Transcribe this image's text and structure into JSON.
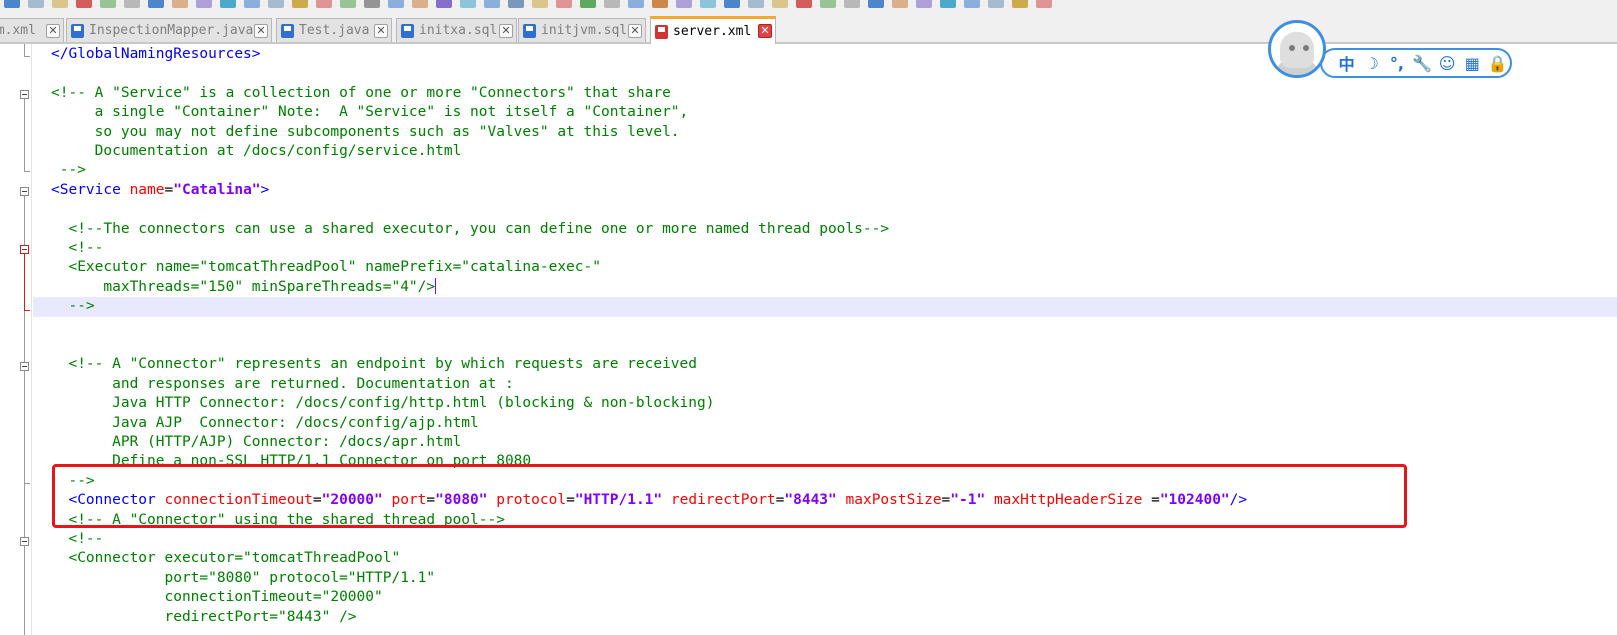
{
  "tabs": [
    {
      "label": "om.xml",
      "active": false,
      "icon": "red-file-icon"
    },
    {
      "label": "InspectionMapper.java",
      "active": false,
      "icon": "blue-file-icon"
    },
    {
      "label": "Test.java",
      "active": false,
      "icon": "blue-file-icon"
    },
    {
      "label": "initxa.sql",
      "active": false,
      "icon": "blue-file-icon"
    },
    {
      "label": "initjvm.sql",
      "active": false,
      "icon": "blue-file-icon"
    },
    {
      "label": "server.xml",
      "active": true,
      "icon": "red-file-icon"
    }
  ],
  "tab_close_glyph": "✕",
  "ime_toolbar": {
    "items": [
      "中",
      "☽",
      "°,",
      "🔧",
      "☺",
      "▦",
      "🔒"
    ]
  },
  "editor": {
    "language": "xml",
    "current_line_index": 12,
    "highlight_box_lines": [
      21,
      23
    ],
    "colors": {
      "comment": "#008000",
      "tag": "#0000ff",
      "attribute": "#ff0000",
      "string": "#8000ff",
      "current_line": "#e8e8ff",
      "highlight_box": "#e8141a"
    },
    "lines": [
      [
        [
          "tag",
          "</GlobalNamingResources>"
        ]
      ],
      [],
      [
        [
          "com",
          "<!-- A \"Service\" is a collection of one or more \"Connectors\" that share"
        ]
      ],
      [
        [
          "com",
          "     a single \"Container\" Note:  A \"Service\" is not itself a \"Container\","
        ]
      ],
      [
        [
          "com",
          "     so you may not define subcomponents such as \"Valves\" at this level."
        ]
      ],
      [
        [
          "com",
          "     Documentation at /docs/config/service.html"
        ]
      ],
      [
        [
          "com",
          " -->"
        ]
      ],
      [
        [
          "tag",
          "<Service "
        ],
        [
          "attr",
          "name"
        ],
        [
          "op",
          "="
        ],
        [
          "str",
          "\"Catalina\""
        ],
        [
          "tag",
          ">"
        ]
      ],
      [],
      [
        [
          "com",
          "  <!--The connectors can use a shared executor, you can define one or more named thread pools-->"
        ]
      ],
      [
        [
          "com",
          "  <!--"
        ]
      ],
      [
        [
          "com",
          "  <Executor name=\"tomcatThreadPool\" namePrefix=\"catalina-exec-\""
        ]
      ],
      [
        [
          "com",
          "      maxThreads=\"150\" minSpareThreads=\"4\"/>"
        ]
      ],
      [
        [
          "com",
          "  -->"
        ]
      ],
      [],
      [],
      [
        [
          "com",
          "  <!-- A \"Connector\" represents an endpoint by which requests are received"
        ]
      ],
      [
        [
          "com",
          "       and responses are returned. Documentation at :"
        ]
      ],
      [
        [
          "com",
          "       Java HTTP Connector: /docs/config/http.html (blocking & non-blocking)"
        ]
      ],
      [
        [
          "com",
          "       Java AJP  Connector: /docs/config/ajp.html"
        ]
      ],
      [
        [
          "com",
          "       APR (HTTP/AJP) Connector: /docs/apr.html"
        ]
      ],
      [
        [
          "com",
          "       Define a non-SSL HTTP/1.1 Connector on port 8080"
        ]
      ],
      [
        [
          "com",
          "  -->"
        ]
      ],
      [
        [
          "tag",
          "  <Connector "
        ],
        [
          "attr",
          "connectionTimeout"
        ],
        [
          "op",
          "="
        ],
        [
          "str",
          "\"20000\""
        ],
        [
          "op",
          " "
        ],
        [
          "attr",
          "port"
        ],
        [
          "op",
          "="
        ],
        [
          "str",
          "\"8080\""
        ],
        [
          "op",
          " "
        ],
        [
          "attr",
          "protocol"
        ],
        [
          "op",
          "="
        ],
        [
          "str",
          "\"HTTP/1.1\""
        ],
        [
          "op",
          " "
        ],
        [
          "attr",
          "redirectPort"
        ],
        [
          "op",
          "="
        ],
        [
          "str",
          "\"8443\""
        ],
        [
          "op",
          " "
        ],
        [
          "attr",
          "maxPostSize"
        ],
        [
          "op",
          "="
        ],
        [
          "str",
          "\"-1\""
        ],
        [
          "op",
          " "
        ],
        [
          "attr",
          "maxHttpHeaderSize"
        ],
        [
          "op",
          " ="
        ],
        [
          "str",
          "\"102400\""
        ],
        [
          "tag",
          "/>"
        ]
      ],
      [
        [
          "com",
          "  <!-- A \"Connector\" using the shared thread pool-->"
        ]
      ],
      [
        [
          "com",
          "  <!--"
        ]
      ],
      [
        [
          "com",
          "  <Connector executor=\"tomcatThreadPool\""
        ]
      ],
      [
        [
          "com",
          "             port=\"8080\" protocol=\"HTTP/1.1\""
        ]
      ],
      [
        [
          "com",
          "             connectionTimeout=\"20000\""
        ]
      ],
      [
        [
          "com",
          "             redirectPort=\"8443\" />"
        ]
      ]
    ]
  }
}
